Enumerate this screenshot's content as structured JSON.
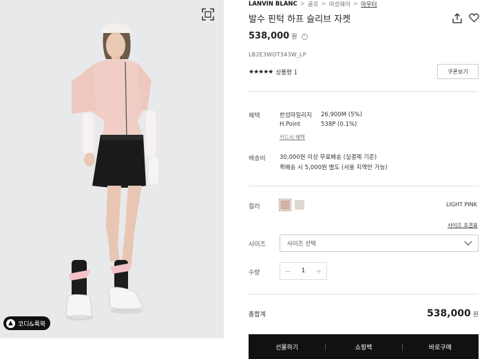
{
  "image": {
    "coordi_label": "코디&룩북"
  },
  "breadcrumb": {
    "brand": "LANVIN BLANC",
    "items": [
      "골프",
      "여성웨어",
      "아우터"
    ]
  },
  "product": {
    "title": "발수 핀턱 하프 슬리브 자켓",
    "price": "538,000",
    "price_unit": "원",
    "info_icon": "?",
    "sku": "LB2E3WOT343W_LP",
    "stars": "★★★★★",
    "review_label": "상품평 1",
    "coupon_label": "쿠폰보기"
  },
  "benefit": {
    "label": "혜택",
    "rows": [
      {
        "name": "한섬마일리지",
        "value": "26,900M (5%)"
      },
      {
        "name": "H.Point",
        "value": "538P (0.1%)"
      }
    ],
    "card_link": "카드사 혜택"
  },
  "shipping": {
    "label": "배송비",
    "lines": [
      "30,000원 이상 무료배송 (실결제 기준)",
      "퀵배송 시 5,000원 별도 (서울 지역만 가능)"
    ]
  },
  "color": {
    "label": "컬러",
    "selected_name": "LIGHT PINK",
    "swatches": [
      "#d1b0a6",
      "#dcd9d0"
    ],
    "size_guide": "사이즈 조견표"
  },
  "size": {
    "label": "사이즈",
    "placeholder": "사이즈 선택"
  },
  "quantity": {
    "label": "수량",
    "minus": "−",
    "value": "1",
    "plus": "+"
  },
  "total": {
    "label": "총합계",
    "price": "538,000",
    "unit": "원"
  },
  "actions": {
    "gift": "선물하기",
    "cart": "쇼핑백",
    "buy": "바로구매"
  }
}
